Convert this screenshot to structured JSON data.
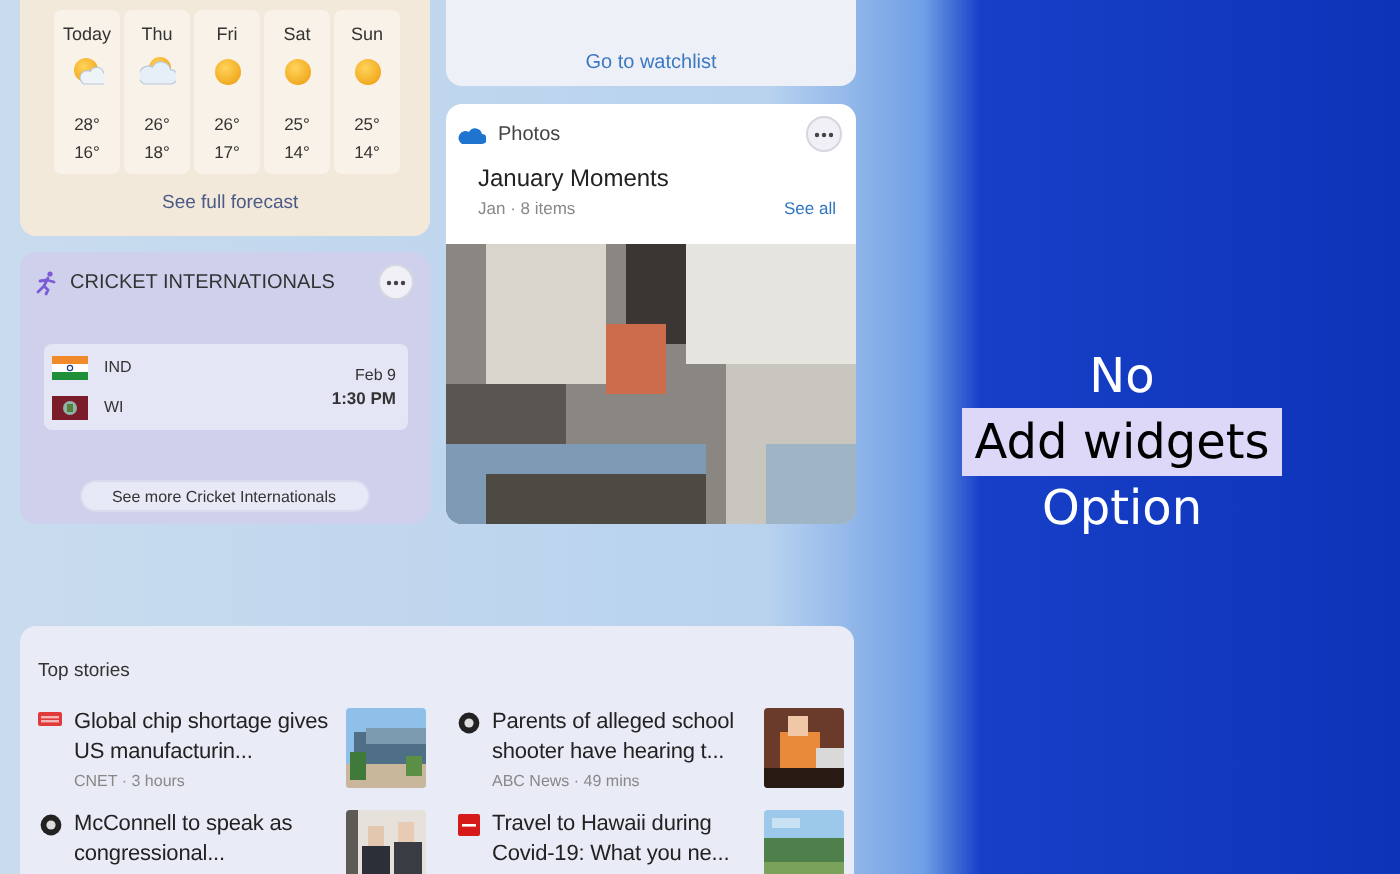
{
  "weather": {
    "days": [
      {
        "day": "Today",
        "high": "28°",
        "low": "16°"
      },
      {
        "day": "Thu",
        "high": "26°",
        "low": "18°"
      },
      {
        "day": "Fri",
        "high": "26°",
        "low": "17°"
      },
      {
        "day": "Sat",
        "high": "25°",
        "low": "14°"
      },
      {
        "day": "Sun",
        "high": "25°",
        "low": "14°"
      }
    ],
    "link": "See full forecast"
  },
  "watchlist": {
    "link": "Go to watchlist"
  },
  "cricket": {
    "title": "CRICKET INTERNATIONALS",
    "match": {
      "teams": [
        {
          "name": "IND"
        },
        {
          "name": "WI"
        }
      ],
      "date": "Feb 9",
      "time": "1:30 PM"
    },
    "button": "See more Cricket Internationals"
  },
  "photos": {
    "title": "Photos",
    "album": "January Moments",
    "meta": "Jan · 8 items",
    "link": "See all"
  },
  "top_stories": {
    "title": "Top stories",
    "stories": [
      {
        "headline": "Global chip shortage gives US manufacturin...",
        "source": "CNET · 3 hours"
      },
      {
        "headline": "Parents of alleged school shooter have hearing t...",
        "source": "ABC News · 49 mins"
      },
      {
        "headline": "McConnell to speak as congressional..."
      },
      {
        "headline": "Travel to Hawaii during Covid-19: What you ne..."
      }
    ]
  },
  "callout": {
    "lines": [
      {
        "text": "No",
        "highlighted": false
      },
      {
        "text": "Add widgets",
        "highlighted": true
      },
      {
        "text": "Option",
        "highlighted": false
      }
    ]
  }
}
